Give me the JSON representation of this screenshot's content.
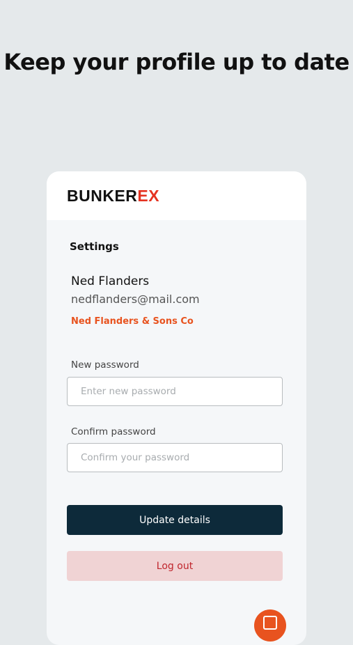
{
  "headline": "Keep your profile up to date",
  "header": {
    "logo_main": "BUNKER",
    "logo_accent": "EX"
  },
  "settings": {
    "title": "Settings",
    "user": {
      "name": "Ned Flanders",
      "email": "nedflanders@mail.com",
      "company": "Ned Flanders & Sons Co"
    },
    "new_password": {
      "label": "New password",
      "placeholder": "Enter new password",
      "value": ""
    },
    "confirm_password": {
      "label": "Confirm password",
      "placeholder": "Confirm your password",
      "value": ""
    },
    "update_label": "Update details",
    "logout_label": "Log out"
  },
  "chat": {
    "icon": "chat-icon"
  },
  "colors": {
    "background": "#e5e9eb",
    "brand_accent": "#e53321",
    "company_text": "#e8531f",
    "primary_button": "#0d2a3a",
    "logout_button": "#f0d3d4",
    "logout_text": "#c0262d",
    "chat_fab": "#e8531f"
  }
}
